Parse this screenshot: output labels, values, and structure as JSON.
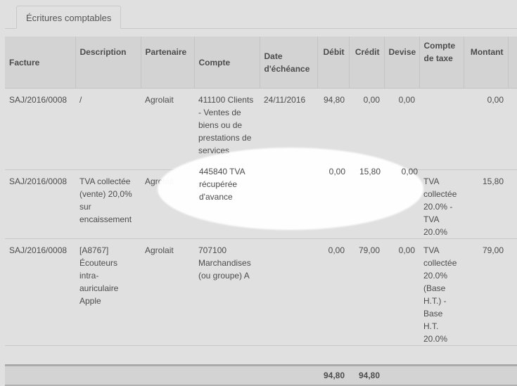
{
  "tabs": [
    {
      "label": "Écritures comptables",
      "active": true
    }
  ],
  "table": {
    "columns": [
      "Facture",
      "Description",
      "Partenaire",
      "Compte",
      "Date d'échéance",
      "Débit",
      "Crédit",
      "Devise",
      "Compte de taxe",
      "Montant"
    ],
    "rows": [
      {
        "facture": "SAJ/2016/0008",
        "description": "/",
        "partenaire": "Agrolait",
        "compte": "411100 Clients - Ventes de biens ou de prestations de services",
        "date": "24/11/2016",
        "debit": "94,80",
        "credit": "0,00",
        "devise": "0,00",
        "compte_taxe": "",
        "montant": "0,00"
      },
      {
        "facture": "SAJ/2016/0008",
        "description": "TVA collectée (vente) 20,0% sur encaissement",
        "partenaire": "Agrolait",
        "compte": "445840 TVA récupérée d'avance",
        "date": "",
        "debit": "0,00",
        "credit": "15,80",
        "devise": "0,00",
        "compte_taxe": "TVA collectée 20.0% - TVA 20.0%",
        "montant": "15,80"
      },
      {
        "facture": "SAJ/2016/0008",
        "description": "[A8767] Écouteurs intra-auriculaire Apple",
        "partenaire": "Agrolait",
        "compte": "707100 Marchandises (ou groupe) A",
        "date": "",
        "debit": "0,00",
        "credit": "79,00",
        "devise": "0,00",
        "compte_taxe": "TVA collectée 20.0% (Base H.T.) - Base H.T. 20.0%",
        "montant": "79,00"
      }
    ],
    "totals": {
      "debit": "94,80",
      "credit": "94,80"
    }
  },
  "highlight_color": "#ffffff"
}
